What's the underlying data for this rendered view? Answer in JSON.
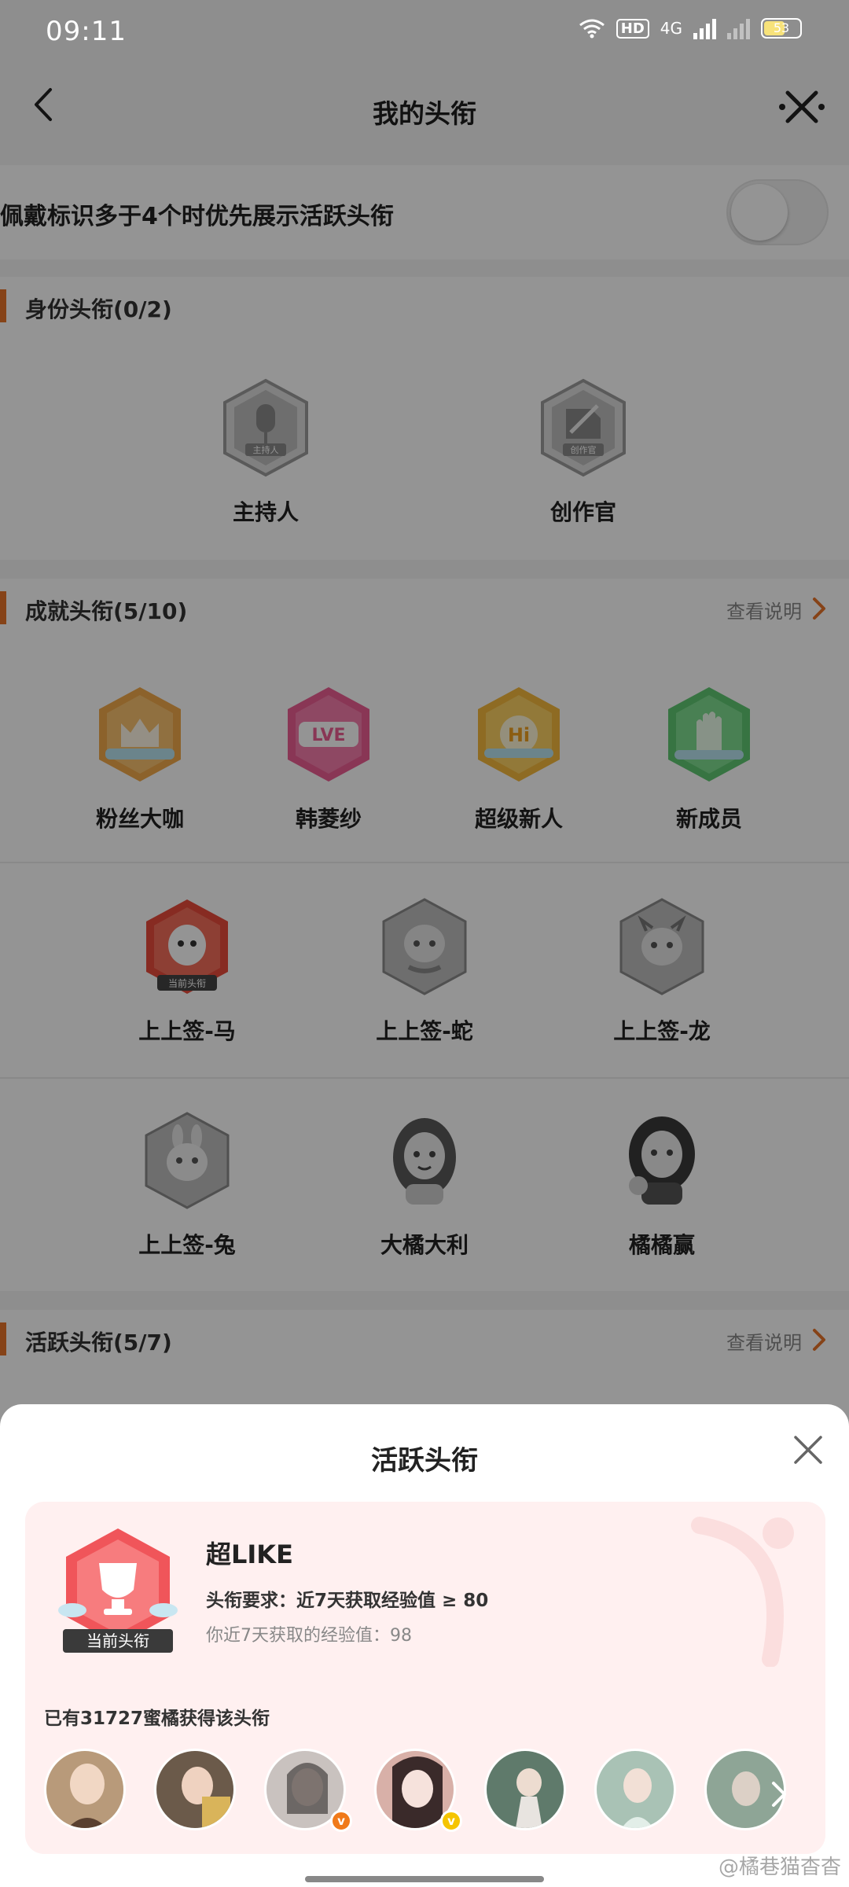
{
  "status_bar": {
    "time": "09:11",
    "hd_label": "HD",
    "network_label": "4G",
    "battery_level": "53"
  },
  "nav": {
    "title": "我的头衔"
  },
  "settings": {
    "priority_toggle_label": "佩戴标识多于4个时优先展示活跃头衔",
    "priority_toggle_on": false
  },
  "identity_section": {
    "title": "身份头衔(0/2)",
    "badges": [
      {
        "label": "主持人",
        "hex_text": "主持人"
      },
      {
        "label": "创作官",
        "hex_text": "创作官"
      }
    ]
  },
  "achievement_section": {
    "title": "成就头衔(5/10)",
    "link_label": "查看说明",
    "badges": [
      {
        "label": "粉丝大咖",
        "color": "#f2a94b",
        "icon": "crown-icon"
      },
      {
        "label": "韩菱纱",
        "color": "#ec5d93",
        "icon": "lv-icon",
        "icon_text": "LVE"
      },
      {
        "label": "超级新人",
        "color": "#f5b93d",
        "icon": "hi-icon",
        "icon_text": "Hi"
      },
      {
        "label": "新成员",
        "color": "#5fc873",
        "icon": "hand-icon"
      },
      {
        "label": "上上签-马",
        "color": "#e84b3c",
        "icon": "horse-icon",
        "tag": "当前头衔"
      },
      {
        "label": "上上签-蛇",
        "color": "#9a9a9a",
        "icon": "snake-icon"
      },
      {
        "label": "上上签-龙",
        "color": "#9a9a9a",
        "icon": "dragon-icon"
      },
      {
        "label": "上上签-兔",
        "color": "#9a9a9a",
        "icon": "rabbit-icon"
      },
      {
        "label": "大橘大利",
        "color": "#9a9a9a",
        "icon": "girl-icon"
      },
      {
        "label": "橘橘赢",
        "color": "#9a9a9a",
        "icon": "girl-icon"
      }
    ]
  },
  "active_section": {
    "title": "活跃头衔(5/7)",
    "link_label": "查看说明"
  },
  "sheet": {
    "title": "活跃头衔",
    "badge_name": "超LIKE",
    "badge_tag": "当前头衔",
    "requirement": "头衔要求：近7天获取经验值 ≥ 80",
    "current_exp": "你近7天获取的经验值：98",
    "holder_count": "已有31727蜜橘获得该头衔",
    "colors": {
      "accent": "#e7742a",
      "card_bg": "#fff0f0",
      "badge_red": "#f0555a"
    },
    "avatars": [
      {
        "name": "avatar-1",
        "tone": "#b89a7a",
        "verified": null
      },
      {
        "name": "avatar-2",
        "tone": "#6b5a4a",
        "verified": null
      },
      {
        "name": "avatar-3",
        "tone": "#c9c2bf",
        "verified": "orange"
      },
      {
        "name": "avatar-4",
        "tone": "#d8b0a8",
        "verified": "yellow"
      },
      {
        "name": "avatar-5",
        "tone": "#5f7a6b",
        "verified": null
      },
      {
        "name": "avatar-6",
        "tone": "#a9c2b5",
        "verified": null
      },
      {
        "name": "avatar-7",
        "tone": "#8ea596",
        "verified": null
      }
    ]
  },
  "watermark": "@橘巷猫杳杳"
}
